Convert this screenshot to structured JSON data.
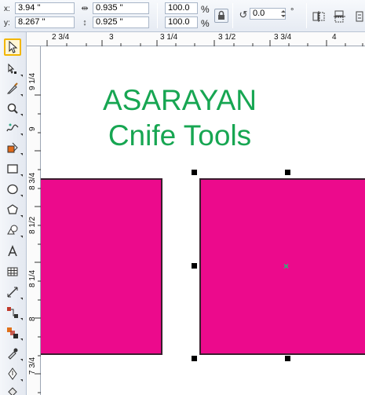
{
  "property_bar": {
    "x_label": "x:",
    "x_value": "3.94 \"",
    "y_label": "y:",
    "y_value": "8.267 \"",
    "width_value": "0.935 \"",
    "height_value": "0.925 \"",
    "scale_x": "100.0",
    "scale_y": "100.0",
    "percent_1": "%",
    "percent_2": "%",
    "rotation_value": "0.0",
    "degree_symbol": "°"
  },
  "ruler_h": {
    "labels": [
      "2 3/4",
      "3",
      "3 1/4",
      "3 1/2",
      "3 3/4",
      "4"
    ]
  },
  "ruler_v": {
    "labels": [
      "9 1/4",
      "9",
      "8 3/4",
      "8 1/2",
      "8 1/4",
      "8",
      "7 3/4"
    ]
  },
  "canvas": {
    "title_line1": "ASARAYAN",
    "title_line2": "Cnife Tools",
    "title_color": "#17a652",
    "shape_fill": "#ec0a8c"
  },
  "toolbox": {
    "tools": [
      "pick-tool",
      "shape-tool",
      "knife-tool",
      "zoom-tool",
      "freehand-tool",
      "smart-fill-tool",
      "rectangle-tool",
      "ellipse-tool",
      "polygon-tool",
      "basic-shapes-tool",
      "text-tool",
      "table-tool",
      "dimension-tool",
      "connector-tool",
      "blend-tool",
      "eyedropper-tool",
      "outline-tool",
      "fill-tool"
    ]
  }
}
